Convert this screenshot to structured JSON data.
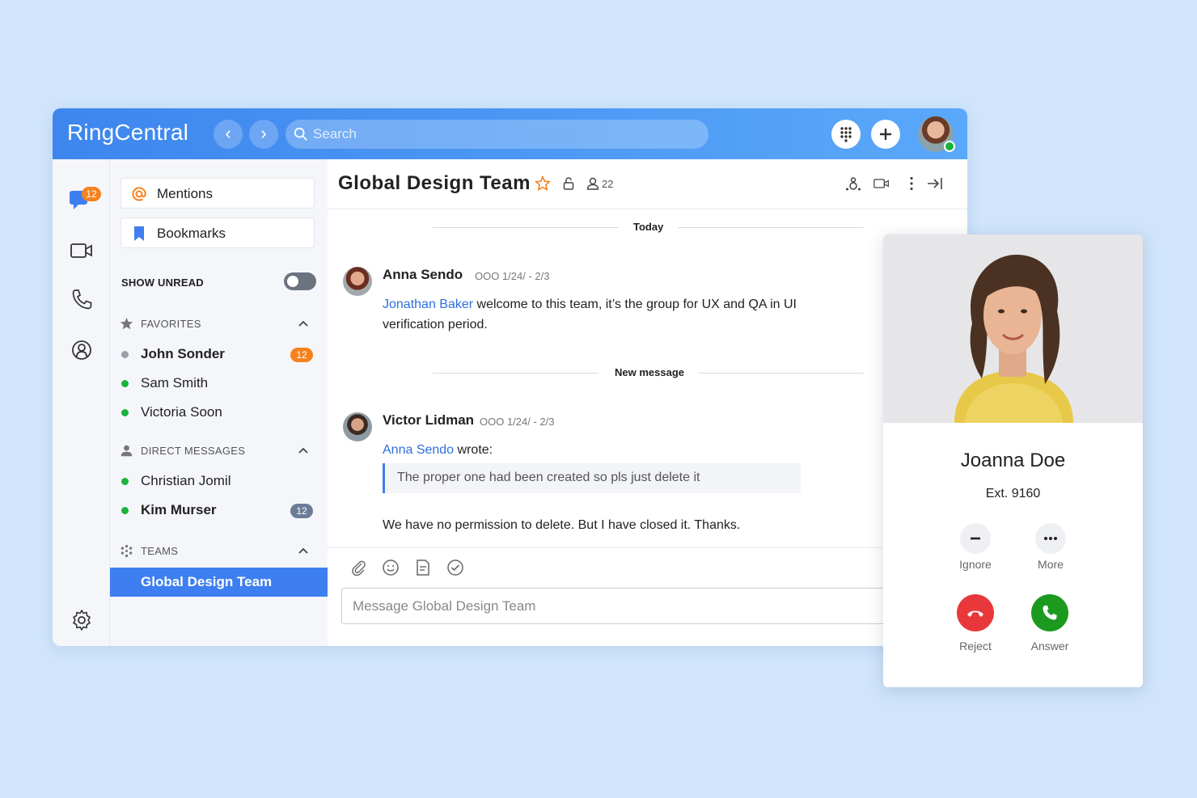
{
  "app": {
    "brand": "RingCentral",
    "search_placeholder": "Search"
  },
  "rail": {
    "messages_badge": "12"
  },
  "sidebar": {
    "mentions_label": "Mentions",
    "bookmarks_label": "Bookmarks",
    "show_unread_label": "SHOW UNREAD",
    "show_unread_on": false,
    "favorites": {
      "label": "FAVORITES",
      "items": [
        {
          "name": "John Sonder",
          "bold": true,
          "badge": "12",
          "status": "away"
        },
        {
          "name": "Sam Smith",
          "bold": false,
          "status": "online"
        },
        {
          "name": "Victoria Soon",
          "bold": false,
          "status": "online"
        }
      ]
    },
    "direct_messages": {
      "label": "DIRECT MESSAGES",
      "items": [
        {
          "name": "Christian Jomil",
          "bold": false,
          "status": "online"
        },
        {
          "name": "Kim Murser",
          "bold": true,
          "badge": "12",
          "status": "online"
        }
      ]
    },
    "teams": {
      "label": "TEAMS",
      "items": [
        {
          "name": "Global Design Team",
          "active": true
        }
      ]
    }
  },
  "chat": {
    "title": "Global Design Team",
    "member_count": "22",
    "today_label": "Today",
    "new_message_label": "New message",
    "messages": [
      {
        "sender": "Anna Sendo",
        "status": "OOO 1/24/ - 2/3",
        "mention": "Jonathan Baker",
        "text": "welcome to this team, it’s the group for UX and QA in UI",
        "text_line2": "verification period."
      },
      {
        "sender": "Victor Lidman",
        "status": "OOO 1/24/ - 2/3",
        "quote_author": "Anna Sendo",
        "wrote": "wrote:",
        "quote": "The proper one had been created so pls just delete it",
        "text": "We have no permission to delete. But I have closed it. Thanks."
      }
    ],
    "composer_placeholder": "Message Global Design Team"
  },
  "incoming_call": {
    "caller_name": "Joanna Doe",
    "extension": "Ext. 9160",
    "ignore_label": "Ignore",
    "more_label": "More",
    "reject_label": "Reject",
    "answer_label": "Answer"
  },
  "colors": {
    "accent": "#3d7ff0",
    "badge_orange": "#f5821f",
    "badge_gray": "#6b7d96",
    "online": "#1bb33c",
    "away": "#9aa0a8",
    "reject": "#e8383b",
    "answer": "#1c9a1f"
  }
}
